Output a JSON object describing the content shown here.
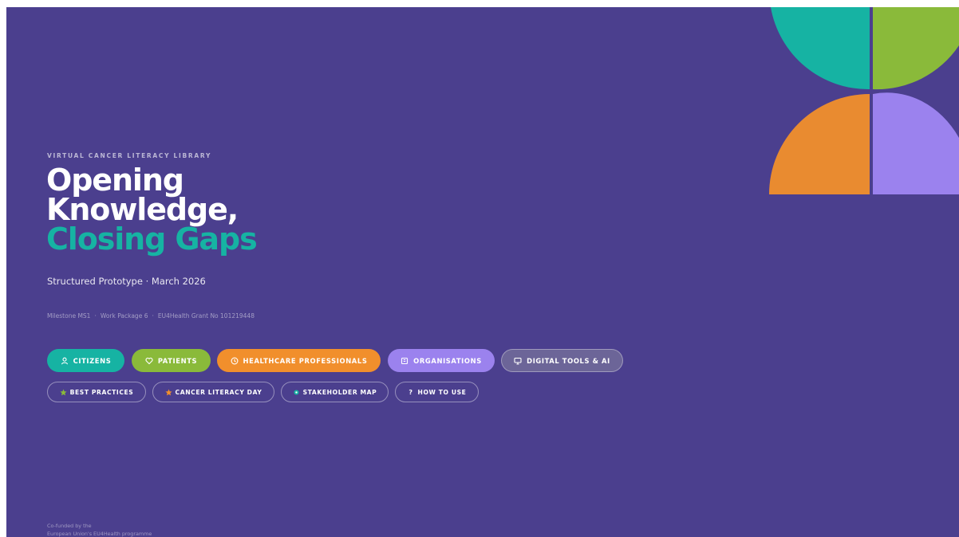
{
  "colors": {
    "background": "#4b3f8e",
    "teal": "#16b3a3",
    "green": "#8aba3a",
    "orange": "#f18f2c",
    "lavender": "#9b82ee",
    "grey_pill": "#6c6598"
  },
  "hero": {
    "eyebrow": "VIRTUAL CANCER LITERACY LIBRARY",
    "title_line1": "Opening",
    "title_line2": "Knowledge,",
    "title_accent": "Closing Gaps",
    "subtitle": "Structured Prototype · March 2026",
    "meta": {
      "milestone": "Milestone MS1",
      "separator": "·",
      "work_package": "Work Package 6",
      "grant": "EU4Health Grant No 101219448"
    }
  },
  "primary_nav": [
    {
      "label": "CITIZENS",
      "icon": "person-icon"
    },
    {
      "label": "PATIENTS",
      "icon": "heart-icon"
    },
    {
      "label": "HEALTHCARE PROFESSIONALS",
      "icon": "clock-icon"
    },
    {
      "label": "ORGANISATIONS",
      "icon": "building-icon"
    },
    {
      "label": "DIGITAL TOOLS & AI",
      "icon": "monitor-icon"
    }
  ],
  "secondary_nav": [
    {
      "label": "BEST PRACTICES",
      "icon": "star-icon"
    },
    {
      "label": "CANCER LITERACY DAY",
      "icon": "star-icon"
    },
    {
      "label": "STAKEHOLDER MAP",
      "icon": "dot-icon"
    },
    {
      "label": "HOW TO USE",
      "icon": "question-icon",
      "glyph": "?"
    }
  ],
  "footer": {
    "line1": "Co-funded by the",
    "line2": "European Union's EU4Health programme"
  }
}
